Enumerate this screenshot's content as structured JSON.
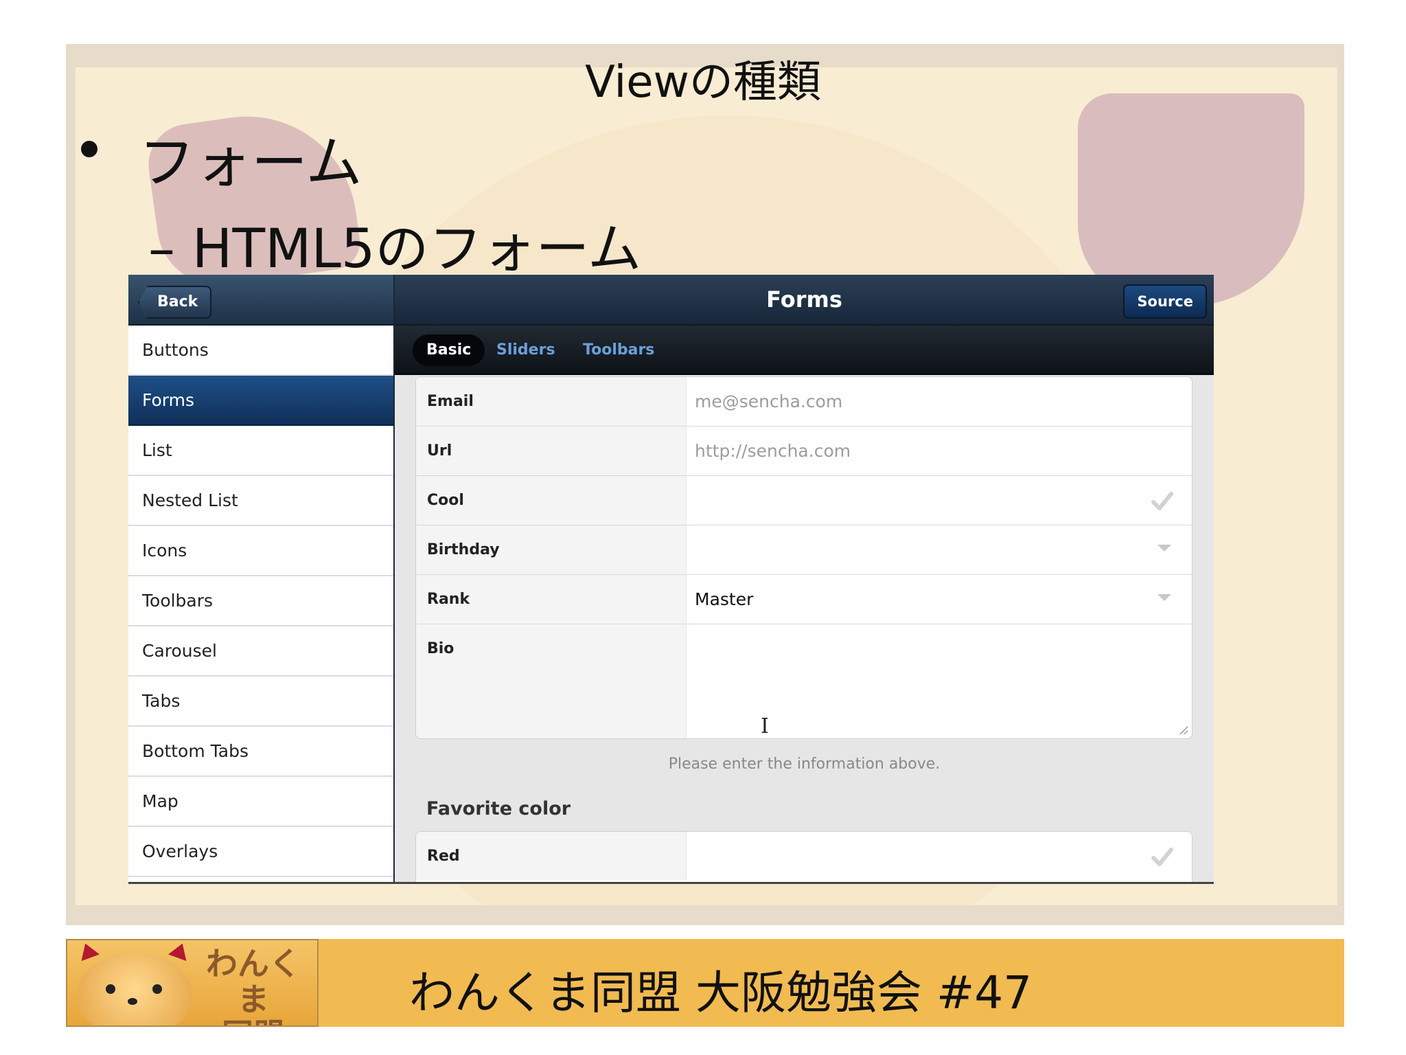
{
  "slide": {
    "title": "Viewの種類",
    "bullet1": "フォーム",
    "bullet2": "– HTML5のフォーム"
  },
  "app": {
    "back_label": "Back",
    "title": "Forms",
    "source_label": "Source",
    "sidebar_items": [
      "Buttons",
      "Forms",
      "List",
      "Nested List",
      "Icons",
      "Toolbars",
      "Carousel",
      "Tabs",
      "Bottom Tabs",
      "Map",
      "Overlays"
    ],
    "active_sidebar_item": "Forms",
    "tabs": [
      "Basic",
      "Sliders",
      "Toolbars"
    ],
    "active_tab": "Basic",
    "fields": {
      "email": {
        "label": "Email",
        "placeholder": "me@sencha.com"
      },
      "url": {
        "label": "Url",
        "placeholder": "http://sencha.com"
      },
      "cool": {
        "label": "Cool"
      },
      "birthday": {
        "label": "Birthday"
      },
      "rank": {
        "label": "Rank",
        "value": "Master"
      },
      "bio": {
        "label": "Bio"
      }
    },
    "hint": "Please enter the information above.",
    "favorite_color": {
      "title": "Favorite color",
      "options": [
        {
          "label": "Red"
        }
      ]
    },
    "icons": {
      "checkbox": "check-icon",
      "select": "chevron-down-icon",
      "cursor": "text-cursor-icon"
    }
  },
  "footer": {
    "logo_line1": "わんくま",
    "logo_line2": "同盟",
    "text": "わんくま同盟 大阪勉強会 #47"
  },
  "colors": {
    "slide_bg": "#f8ecd3",
    "footer_bg": "#f1bb52",
    "active_item": "#1f4f86",
    "tab_text": "#6aa0d8"
  }
}
